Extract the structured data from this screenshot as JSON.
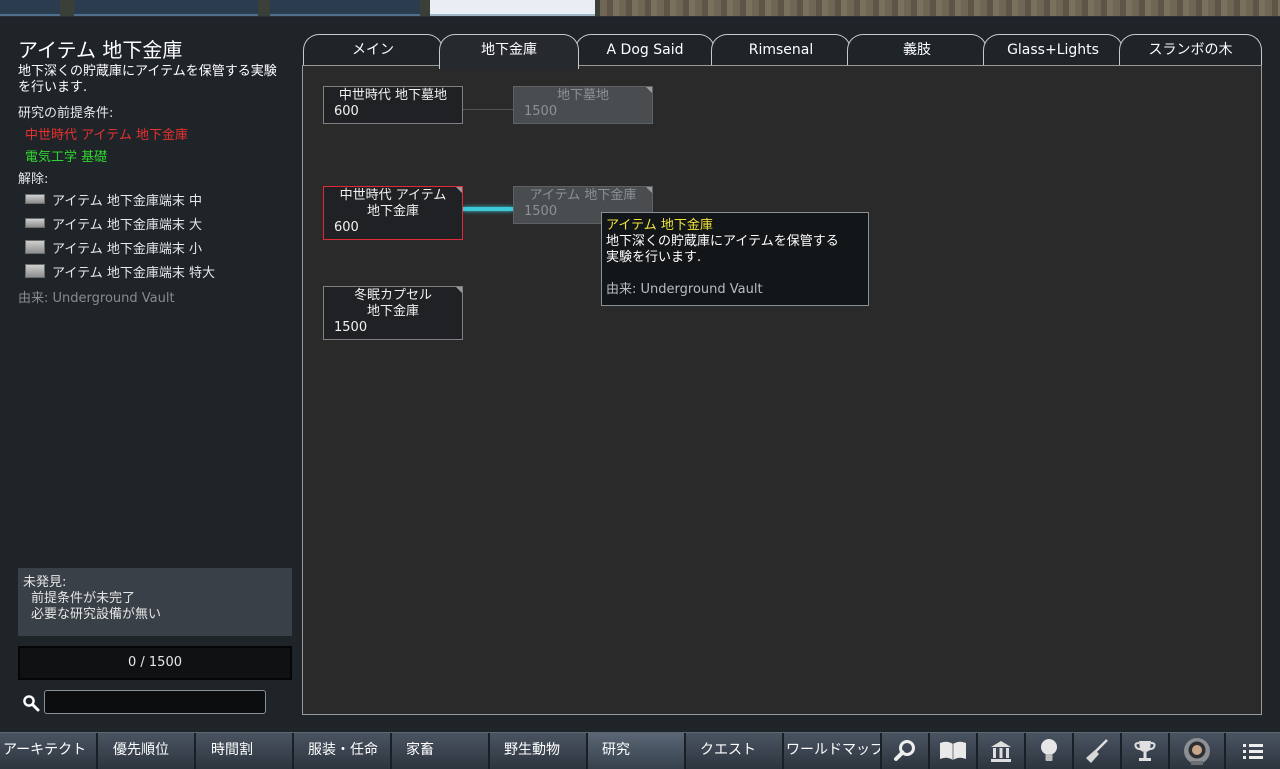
{
  "research": {
    "title": "アイテム 地下金庫",
    "description": "地下深くの貯蔵庫にアイテムを保管する実験を行います.",
    "prereq_label": "研究の前提条件:",
    "prerequisites": [
      {
        "label": "中世時代 アイテム 地下金庫",
        "color": "#e8312f"
      },
      {
        "label": "電気工学 基礎",
        "color": "#2fd52f"
      }
    ],
    "unlocks_label": "解除:",
    "unlocks": [
      "アイテム 地下金庫端末 中",
      "アイテム 地下金庫端末 大",
      "アイテム 地下金庫端末 小",
      "アイテム 地下金庫端末 特大"
    ],
    "source": "由来:  Underground Vault"
  },
  "status": {
    "title": "未発見:",
    "lines": [
      "前提条件が未完了",
      "必要な研究設備が無い"
    ]
  },
  "progress": "0 / 1500",
  "search": {
    "placeholder": "",
    "value": ""
  },
  "tabs": [
    "メイン",
    "地下金庫",
    "A Dog Said",
    "Rimsenal",
    "義肢",
    "Glass+Lights",
    "スランボの木"
  ],
  "active_tab": 1,
  "nodes": [
    {
      "label": "中世時代 地下墓地",
      "cost": "600",
      "state": "available"
    },
    {
      "label": "地下墓地",
      "cost": "1500",
      "state": "locked"
    },
    {
      "label": "中世時代 アイテム 地下金庫",
      "cost": "600",
      "state": "available-selected"
    },
    {
      "label": "アイテム 地下金庫",
      "cost": "1500",
      "state": "locked"
    },
    {
      "label": "冬眠カプセル 地下金庫",
      "cost": "1500",
      "state": "available"
    }
  ],
  "tooltip": {
    "title": "アイテム 地下金庫",
    "description_1": "地下深くの貯蔵庫にアイテムを保管する",
    "description_2": "実験を行います.",
    "source": "由来: Underground Vault"
  },
  "colors": {
    "tooltip_title": "#f0e23c",
    "status_text": "#ffffff",
    "active_link": "#3ec9d9",
    "selected_border": "#e02a36"
  },
  "bottom_bar": {
    "buttons": [
      "アーキテクト",
      "優先順位",
      "時間割",
      "服装・任命",
      "家畜",
      "野生動物",
      "研究",
      "クエスト",
      "ワールドマップ"
    ],
    "icons": [
      "magnifier-icon",
      "book-icon",
      "bank-icon",
      "lightbulb-icon",
      "broom-icon",
      "trophy-icon",
      "astronaut-helmet-icon",
      "menu-list-icon"
    ]
  }
}
